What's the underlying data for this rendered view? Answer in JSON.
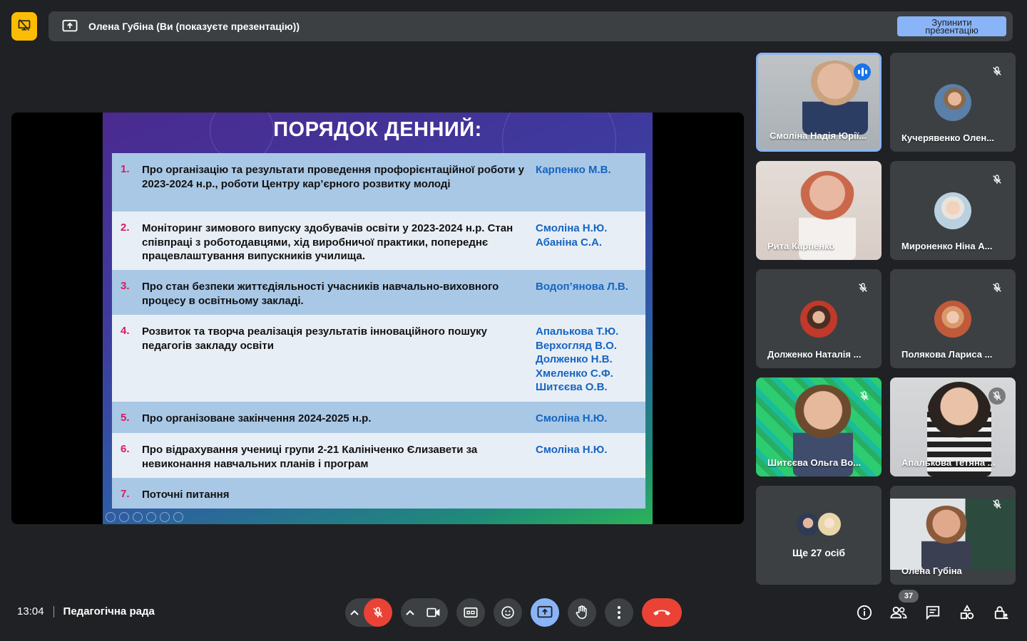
{
  "top_bar": {
    "presenter_label": "Олена Губіна (Ви (показуєте презентацію))",
    "stop_button": "Зупинити презентацію"
  },
  "slide": {
    "title": "ПОРЯДОК ДЕННИЙ:",
    "items": [
      {
        "num": "1.",
        "text": "Про організацію та результати проведення профорієнтаційної роботи у 2023-2024 н.р., роботи Центру кар’єрного розвитку молоді",
        "responsible": [
          "Карпенко М.В."
        ]
      },
      {
        "num": "2.",
        "text": "Моніторинг зимового випуску здобувачів освіти  у 2023-2024 н.р. Стан співпраці з роботодавцями, хід виробничої практики, попереднє працевлаштування випускників училища.",
        "responsible": [
          "Смоліна Н.Ю.",
          "Абаніна С.А."
        ]
      },
      {
        "num": "3.",
        "text": "Про стан безпеки життєдіяльності учасників навчально-виховного процесу в освітньому закладі.",
        "responsible": [
          "Водоп’янова Л.В."
        ]
      },
      {
        "num": "4.",
        "text": "Розвиток та творча реалізація результатів інноваційного пошуку педагогів закладу освіти",
        "responsible": [
          "Апалькова Т.Ю.",
          "Верхогляд В.О.",
          "Долженко Н.В.",
          "Хмеленко С.Ф.",
          "Шитєєва О.В."
        ]
      },
      {
        "num": "5.",
        "text": "Про організоване закінчення 2024-2025 н.р.",
        "responsible": [
          "Смоліна Н.Ю."
        ]
      },
      {
        "num": "6.",
        "text": "Про відрахування учениці групи 2-21 Калініченко Єлизавети за невиконання навчальних планів і програм",
        "responsible": [
          "Смоліна Н.Ю."
        ]
      },
      {
        "num": "7.",
        "text": "Поточні питання",
        "responsible": []
      }
    ]
  },
  "participants": [
    {
      "name": "Смоліна Надія Юрії...",
      "muted": false,
      "speaking": true
    },
    {
      "name": "Кучерявенко Олен...",
      "muted": true
    },
    {
      "name": "Рита Карпенко",
      "muted": false
    },
    {
      "name": "Мироненко Ніна А...",
      "muted": true
    },
    {
      "name": "Долженко Наталія ...",
      "muted": true
    },
    {
      "name": "Полякова Лариса ...",
      "muted": true
    },
    {
      "name": "Шитєєва Ольга Во...",
      "muted": true
    },
    {
      "name": "Апалькова Тетяна ...",
      "muted": true
    },
    {
      "name": "Олена Губіна",
      "muted": true
    }
  ],
  "more_participants": "Ще 27 осіб",
  "bottom_bar": {
    "time": "13:04",
    "meeting_title": "Педагогічна рада",
    "people_count": "37"
  },
  "colors": {
    "accent_blue": "#8ab4f8",
    "end_call_red": "#ea4335",
    "present_yellow": "#fbbc04"
  }
}
